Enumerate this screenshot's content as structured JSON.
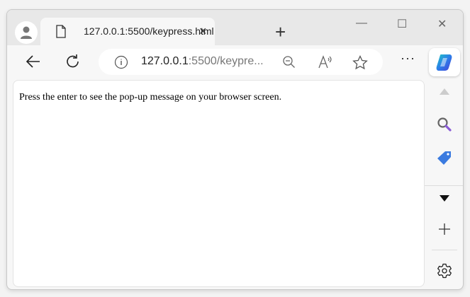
{
  "tab": {
    "title": "127.0.0.1:5500/keypress.html",
    "close": "×",
    "new_tab": "+"
  },
  "window_controls": {
    "minimize": "—",
    "maximize": "☐",
    "close": "✕"
  },
  "address": {
    "host": "127.0.0.1",
    "rest": ":5500/keypre..."
  },
  "toolbar": {
    "more": "···"
  },
  "page": {
    "text": "Press the enter to see the pop-up message on your browser screen."
  },
  "colors": {
    "copilot": "#2b7de9",
    "shopping_tag": "#3b7be0",
    "search_accent": "#8a5cd6"
  }
}
